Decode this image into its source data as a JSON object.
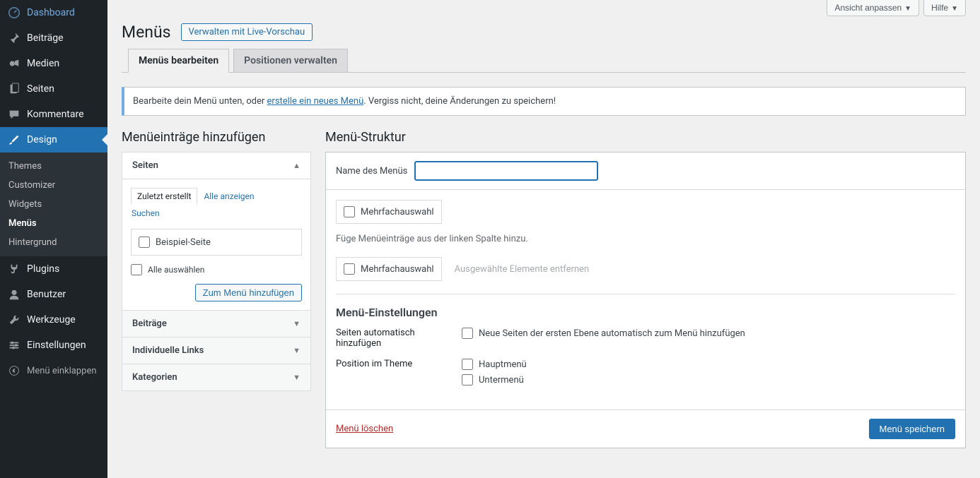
{
  "topbar": {
    "customize_view": "Ansicht anpassen",
    "help": "Hilfe"
  },
  "sidebar": {
    "dashboard": "Dashboard",
    "posts": "Beiträge",
    "media": "Medien",
    "pages": "Seiten",
    "comments": "Kommentare",
    "design": "Design",
    "design_sub": {
      "themes": "Themes",
      "customizer": "Customizer",
      "widgets": "Widgets",
      "menus": "Menüs",
      "background": "Hintergrund"
    },
    "plugins": "Plugins",
    "users": "Benutzer",
    "tools": "Werkzeuge",
    "settings": "Einstellungen",
    "collapse": "Menü einklappen"
  },
  "header": {
    "title": "Menüs",
    "action": "Verwalten mit Live-Vorschau"
  },
  "tabs": {
    "edit": "Menüs bearbeiten",
    "positions": "Positionen verwalten"
  },
  "notice": {
    "prefix": "Bearbeite dein Menü unten, oder ",
    "link": "erstelle ein neues Menü",
    "suffix": ". Vergiss nicht, deine Änderungen zu speichern!"
  },
  "add_items": {
    "heading": "Menüeinträge hinzufügen",
    "acc_pages": "Seiten",
    "tablist": {
      "recent": "Zuletzt erstellt",
      "all": "Alle anzeigen",
      "search": "Suchen"
    },
    "sample_page": "Beispiel-Seite",
    "select_all": "Alle auswählen",
    "add_to_menu": "Zum Menü hinzufügen",
    "acc_posts": "Beiträge",
    "acc_custom": "Individuelle Links",
    "acc_categories": "Kategorien"
  },
  "structure": {
    "heading": "Menü-Struktur",
    "name_label": "Name des Menüs",
    "name_value": "",
    "bulk_select": "Mehrfachauswahl",
    "hint": "Füge Menüeinträge aus der linken Spalte hinzu.",
    "remove_selected": "Ausgewählte Elemente entfernen",
    "settings_heading": "Menü-Einstellungen",
    "auto_label": "Seiten automatisch hinzufügen",
    "auto_check": "Neue Seiten der ersten Ebene automatisch zum Menü hinzufügen",
    "position_label": "Position im Theme",
    "pos_main": "Hauptmenü",
    "pos_sub": "Untermenü",
    "delete": "Menü löschen",
    "save": "Menü speichern"
  }
}
